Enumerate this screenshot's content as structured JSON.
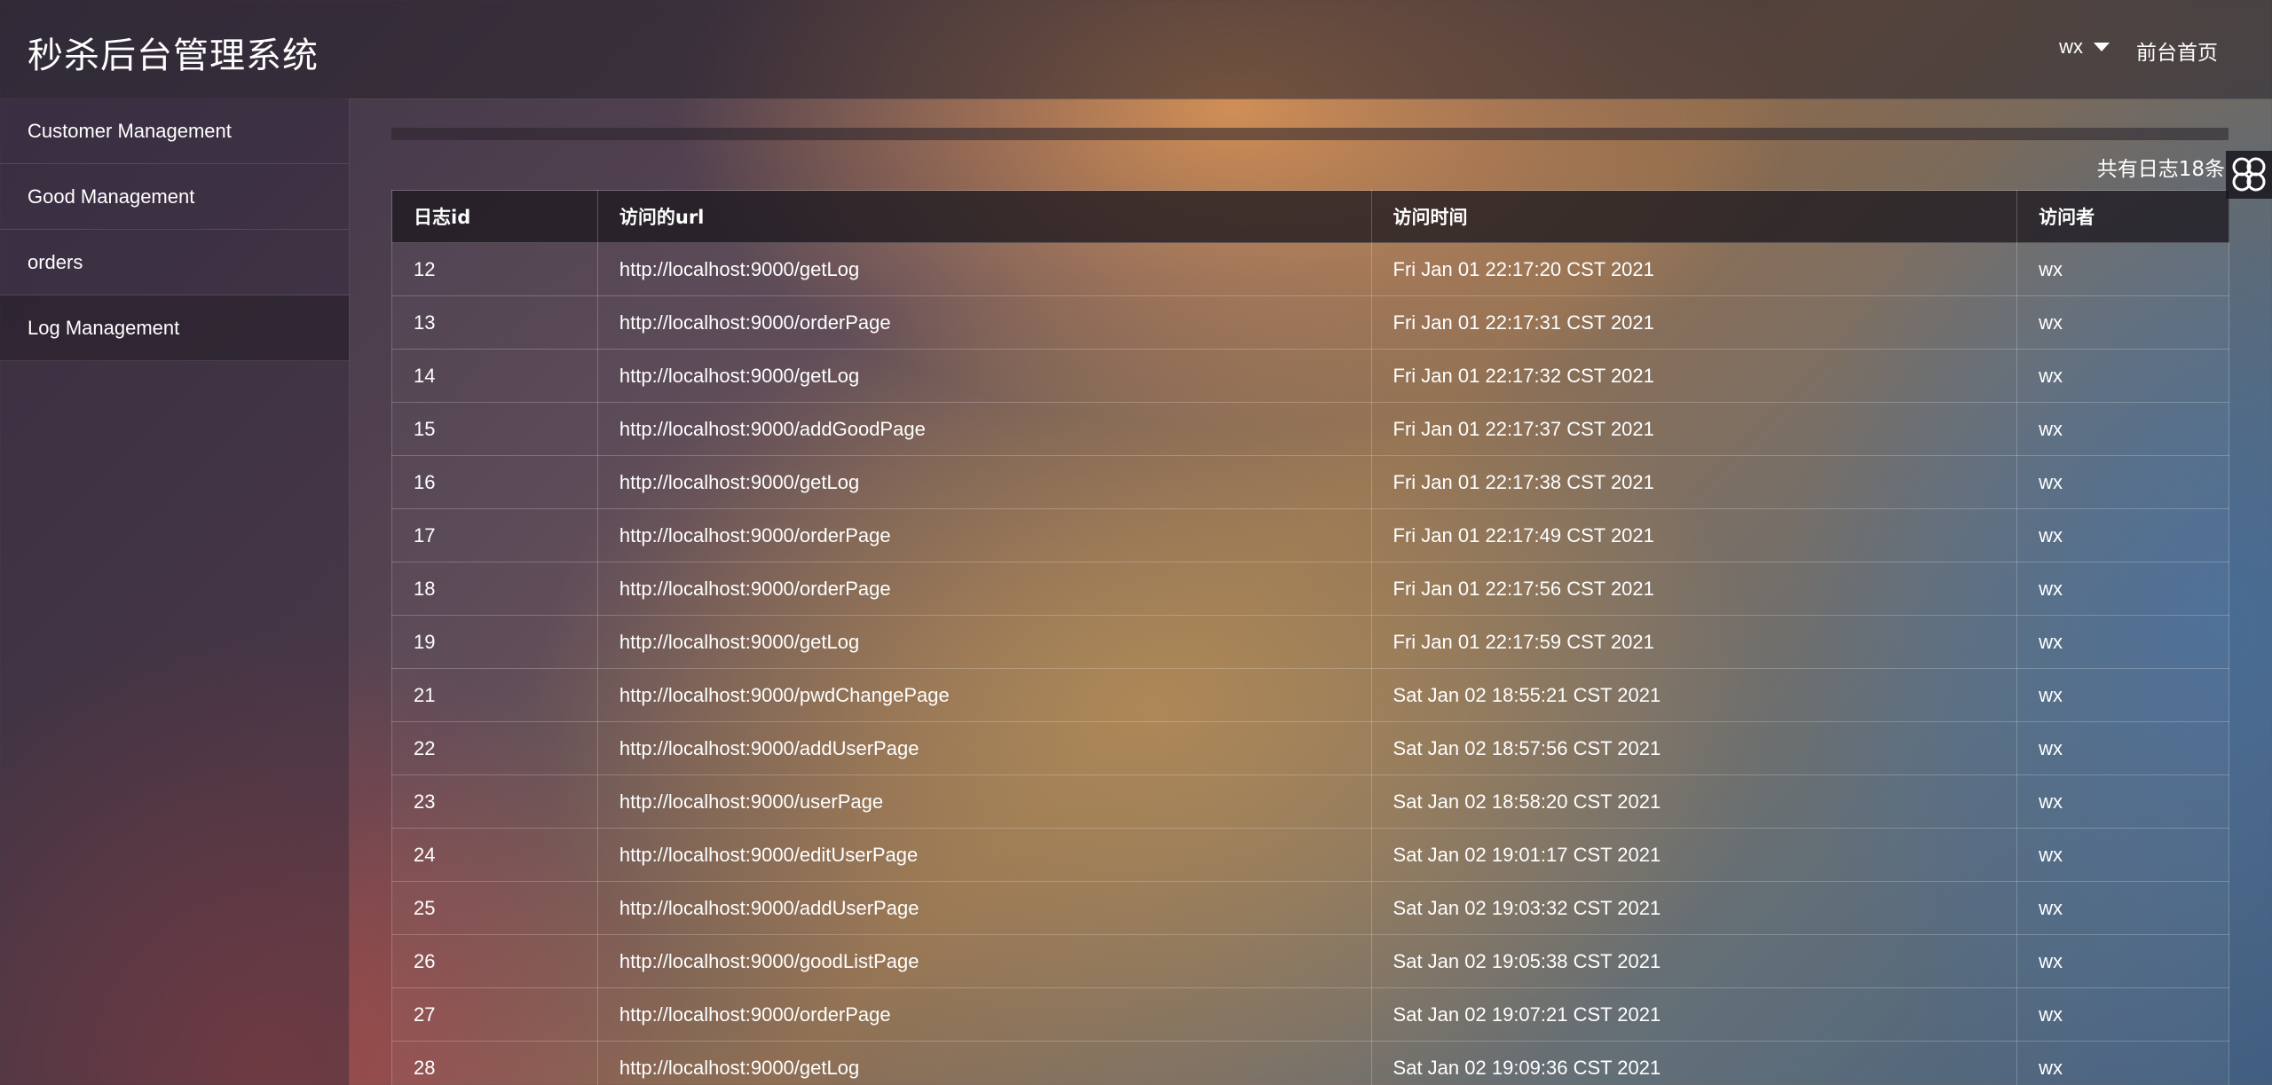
{
  "header": {
    "title": "秒杀后台管理系统",
    "user": "wx",
    "home_link": "前台首页"
  },
  "sidebar": {
    "items": [
      {
        "label": "Customer Management"
      },
      {
        "label": "Good Management"
      },
      {
        "label": "orders"
      },
      {
        "label": "Log Management",
        "active": true
      }
    ]
  },
  "main": {
    "count_text": "共有日志18条",
    "table": {
      "headers": [
        "日志id",
        "访问的url",
        "访问时间",
        "访问者"
      ],
      "rows": [
        [
          "12",
          "http://localhost:9000/getLog",
          "Fri Jan 01 22:17:20 CST 2021",
          "wx"
        ],
        [
          "13",
          "http://localhost:9000/orderPage",
          "Fri Jan 01 22:17:31 CST 2021",
          "wx"
        ],
        [
          "14",
          "http://localhost:9000/getLog",
          "Fri Jan 01 22:17:32 CST 2021",
          "wx"
        ],
        [
          "15",
          "http://localhost:9000/addGoodPage",
          "Fri Jan 01 22:17:37 CST 2021",
          "wx"
        ],
        [
          "16",
          "http://localhost:9000/getLog",
          "Fri Jan 01 22:17:38 CST 2021",
          "wx"
        ],
        [
          "17",
          "http://localhost:9000/orderPage",
          "Fri Jan 01 22:17:49 CST 2021",
          "wx"
        ],
        [
          "18",
          "http://localhost:9000/orderPage",
          "Fri Jan 01 22:17:56 CST 2021",
          "wx"
        ],
        [
          "19",
          "http://localhost:9000/getLog",
          "Fri Jan 01 22:17:59 CST 2021",
          "wx"
        ],
        [
          "21",
          "http://localhost:9000/pwdChangePage",
          "Sat Jan 02 18:55:21 CST 2021",
          "wx"
        ],
        [
          "22",
          "http://localhost:9000/addUserPage",
          "Sat Jan 02 18:57:56 CST 2021",
          "wx"
        ],
        [
          "23",
          "http://localhost:9000/userPage",
          "Sat Jan 02 18:58:20 CST 2021",
          "wx"
        ],
        [
          "24",
          "http://localhost:9000/editUserPage",
          "Sat Jan 02 19:01:17 CST 2021",
          "wx"
        ],
        [
          "25",
          "http://localhost:9000/addUserPage",
          "Sat Jan 02 19:03:32 CST 2021",
          "wx"
        ],
        [
          "26",
          "http://localhost:9000/goodListPage",
          "Sat Jan 02 19:05:38 CST 2021",
          "wx"
        ],
        [
          "27",
          "http://localhost:9000/orderPage",
          "Sat Jan 02 19:07:21 CST 2021",
          "wx"
        ],
        [
          "28",
          "http://localhost:9000/getLog",
          "Sat Jan 02 19:09:36 CST 2021",
          "wx"
        ]
      ]
    }
  },
  "icons": {
    "user_menu": "chevron-down-icon",
    "floating": "flower-icon"
  }
}
